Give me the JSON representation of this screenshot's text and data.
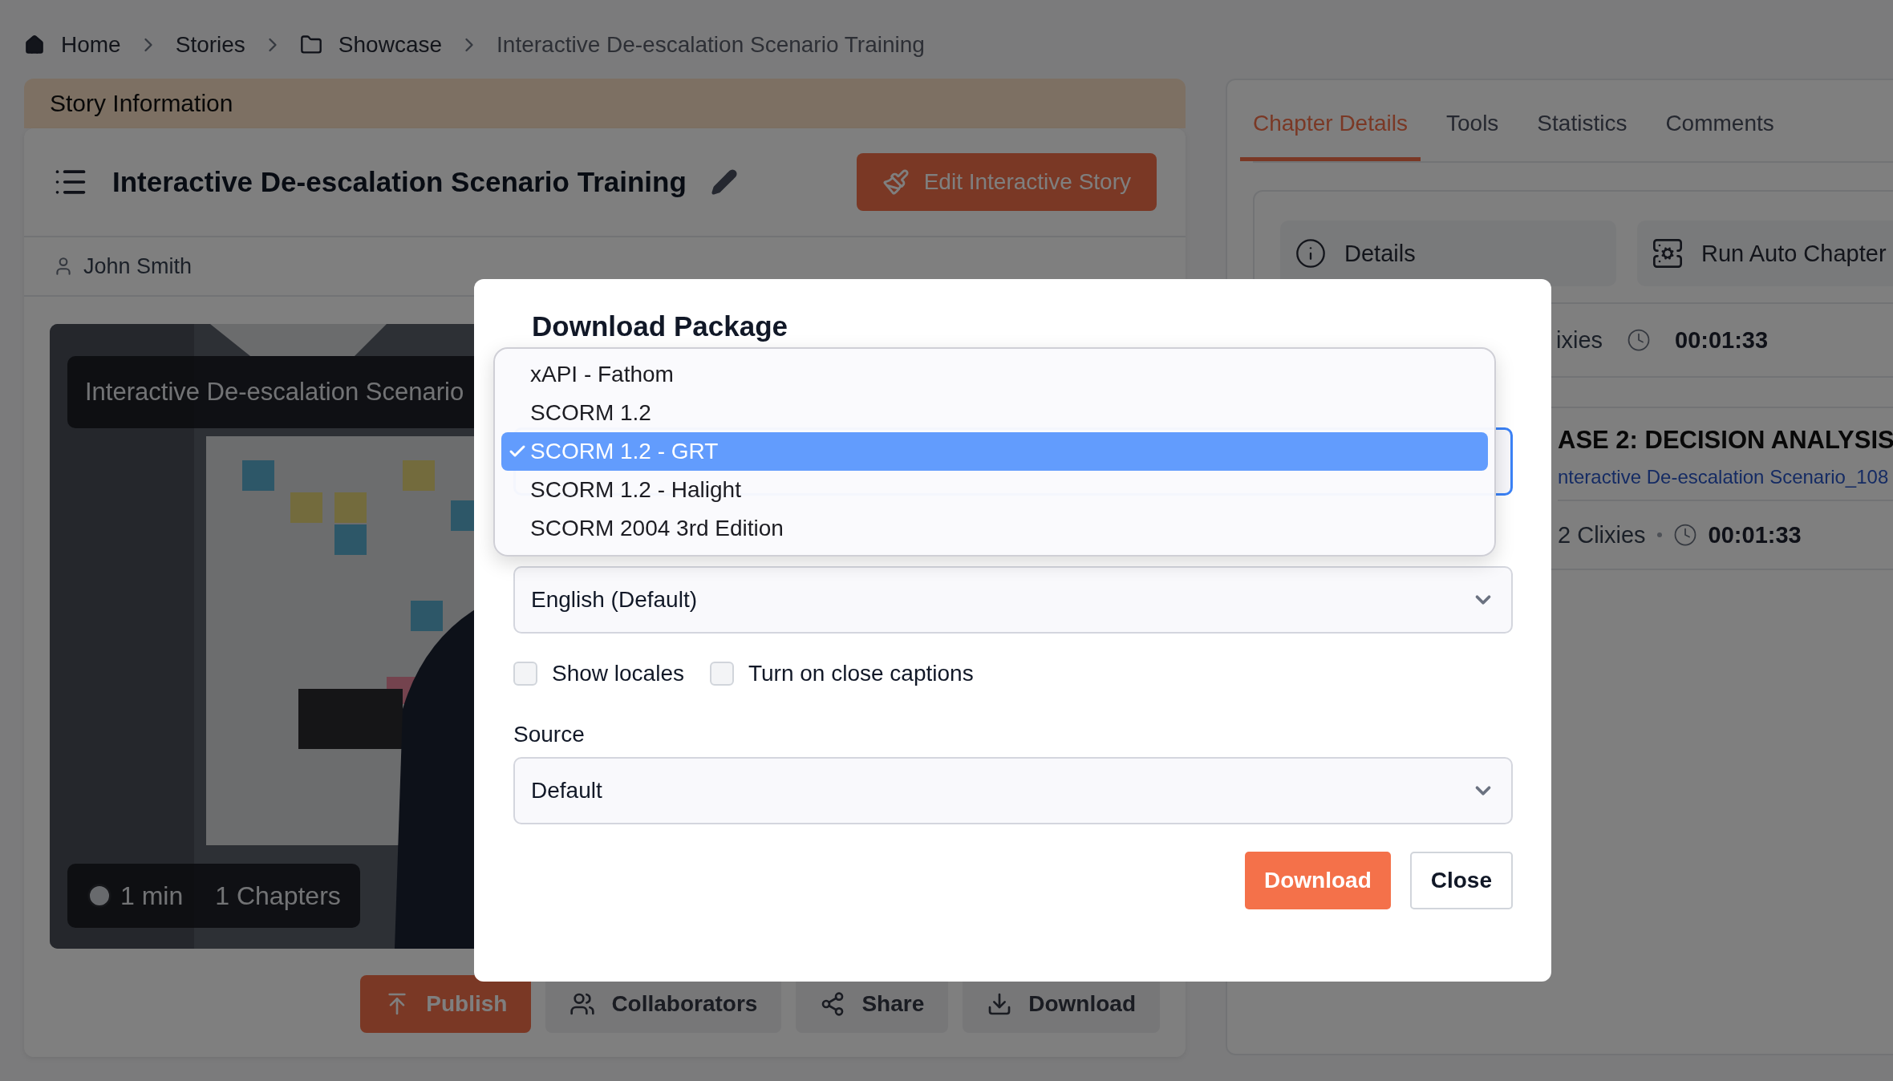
{
  "breadcrumb": [
    {
      "label": "Home",
      "current": false
    },
    {
      "label": "Stories",
      "current": false
    },
    {
      "label": "Showcase",
      "current": false
    },
    {
      "label": "Interactive De-escalation Scenario Training",
      "current": true
    }
  ],
  "story": {
    "header": "Story Information",
    "title": "Interactive De-escalation Scenario Training",
    "edit_button": "Edit Interactive Story",
    "author": "John Smith",
    "preview": {
      "kind": "picture",
      "title": "Interactive De-escalation Scenario",
      "duration": "1 min",
      "chapters": "1 Chapters"
    },
    "actions": [
      {
        "label": "Publish",
        "primary": true
      },
      {
        "label": "Collaborators",
        "primary": false
      },
      {
        "label": "Share",
        "primary": false
      },
      {
        "label": "Download",
        "primary": false
      }
    ]
  },
  "side_panel": {
    "tabs": [
      {
        "label": "Chapter Details",
        "selected": true
      },
      {
        "label": "Tools",
        "selected": false
      },
      {
        "label": "Statistics",
        "selected": false
      },
      {
        "label": "Comments",
        "selected": false
      }
    ],
    "tool_buttons": [
      {
        "label": "Details"
      },
      {
        "label": "Run Auto Chapter"
      }
    ],
    "summary": {
      "count": "ixies",
      "time": "00:01:33"
    },
    "chapter": {
      "title": "ASE 2: DECISION ANALYSIS",
      "link": "nteractive De-escalation Scenario_108",
      "count": "2 Clixies",
      "time": "00:01:33"
    }
  },
  "dialog": {
    "title": "Download Package",
    "format_options": [
      {
        "label": "xAPI - Fathom",
        "selected": false
      },
      {
        "label": "SCORM 1.2",
        "selected": false
      },
      {
        "label": "SCORM 1.2 - GRT",
        "selected": true
      },
      {
        "label": "SCORM 1.2 - Halight",
        "selected": false
      },
      {
        "label": "SCORM 2004 3rd Edition",
        "selected": false
      }
    ],
    "language": "English (Default)",
    "checkboxes": [
      {
        "label": "Show locales",
        "checked": false
      },
      {
        "label": "Turn on close captions",
        "checked": false
      }
    ],
    "source_label": "Source",
    "source": "Default",
    "buttons": [
      {
        "label": "Download",
        "primary": true
      },
      {
        "label": "Close",
        "primary": false
      }
    ]
  }
}
